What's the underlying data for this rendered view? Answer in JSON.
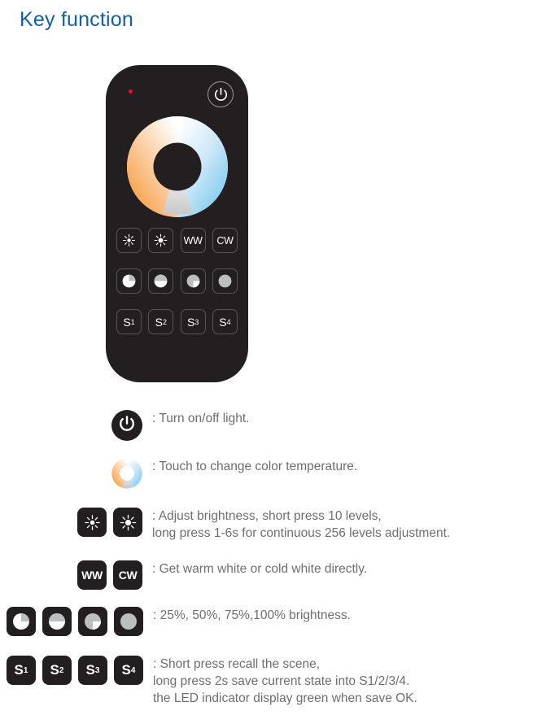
{
  "page": {
    "title": "Key function",
    "title_color": "#1060a8",
    "text_color": "#6d6e71",
    "device_color": "#231f20",
    "led_color": "#e8112d"
  },
  "remote": {
    "led_indicator": "led-indicator-red",
    "power_button": "power-icon",
    "color_wheel": "color-temperature-wheel",
    "buttons": {
      "brightness_row": [
        {
          "name": "brightness-down",
          "icon": "sun-small-icon",
          "label": ""
        },
        {
          "name": "brightness-up",
          "icon": "sun-large-icon",
          "label": ""
        },
        {
          "name": "warm-white",
          "icon": "text",
          "label": "WW"
        },
        {
          "name": "cold-white",
          "icon": "text",
          "label": "CW"
        }
      ],
      "level_row": [
        {
          "name": "level-25",
          "icon": "pie-25-icon",
          "label": ""
        },
        {
          "name": "level-50",
          "icon": "pie-50-icon",
          "label": ""
        },
        {
          "name": "level-75",
          "icon": "pie-75-icon",
          "label": ""
        },
        {
          "name": "level-100",
          "icon": "pie-100-icon",
          "label": ""
        }
      ],
      "scene_row": [
        {
          "name": "scene-1",
          "base": "S",
          "sub": "1"
        },
        {
          "name": "scene-2",
          "base": "S",
          "sub": "2"
        },
        {
          "name": "scene-3",
          "base": "S",
          "sub": "3"
        },
        {
          "name": "scene-4",
          "base": "S",
          "sub": "4"
        }
      ]
    }
  },
  "legend": {
    "power": {
      "text": ": Turn on/off light."
    },
    "color_temperature": {
      "text": ": Touch to change color temperature."
    },
    "brightness": {
      "text": ": Adjust brightness, short press 10 levels,\n   long press 1-6s for continuous 256 levels adjustment."
    },
    "white_modes": {
      "ww_label": "WW",
      "cw_label": "CW",
      "text": ": Get warm white or cold white directly."
    },
    "levels": {
      "text": ": 25%, 50%, 75%,100% brightness."
    },
    "scenes": {
      "buttons": [
        {
          "base": "S",
          "sub": "1"
        },
        {
          "base": "S",
          "sub": "2"
        },
        {
          "base": "S",
          "sub": "3"
        },
        {
          "base": "S",
          "sub": "4"
        }
      ],
      "text": ": Short press recall the scene,\n   long press 2s save current state into S1/2/3/4.\n   the LED indicator display green when save OK."
    }
  }
}
